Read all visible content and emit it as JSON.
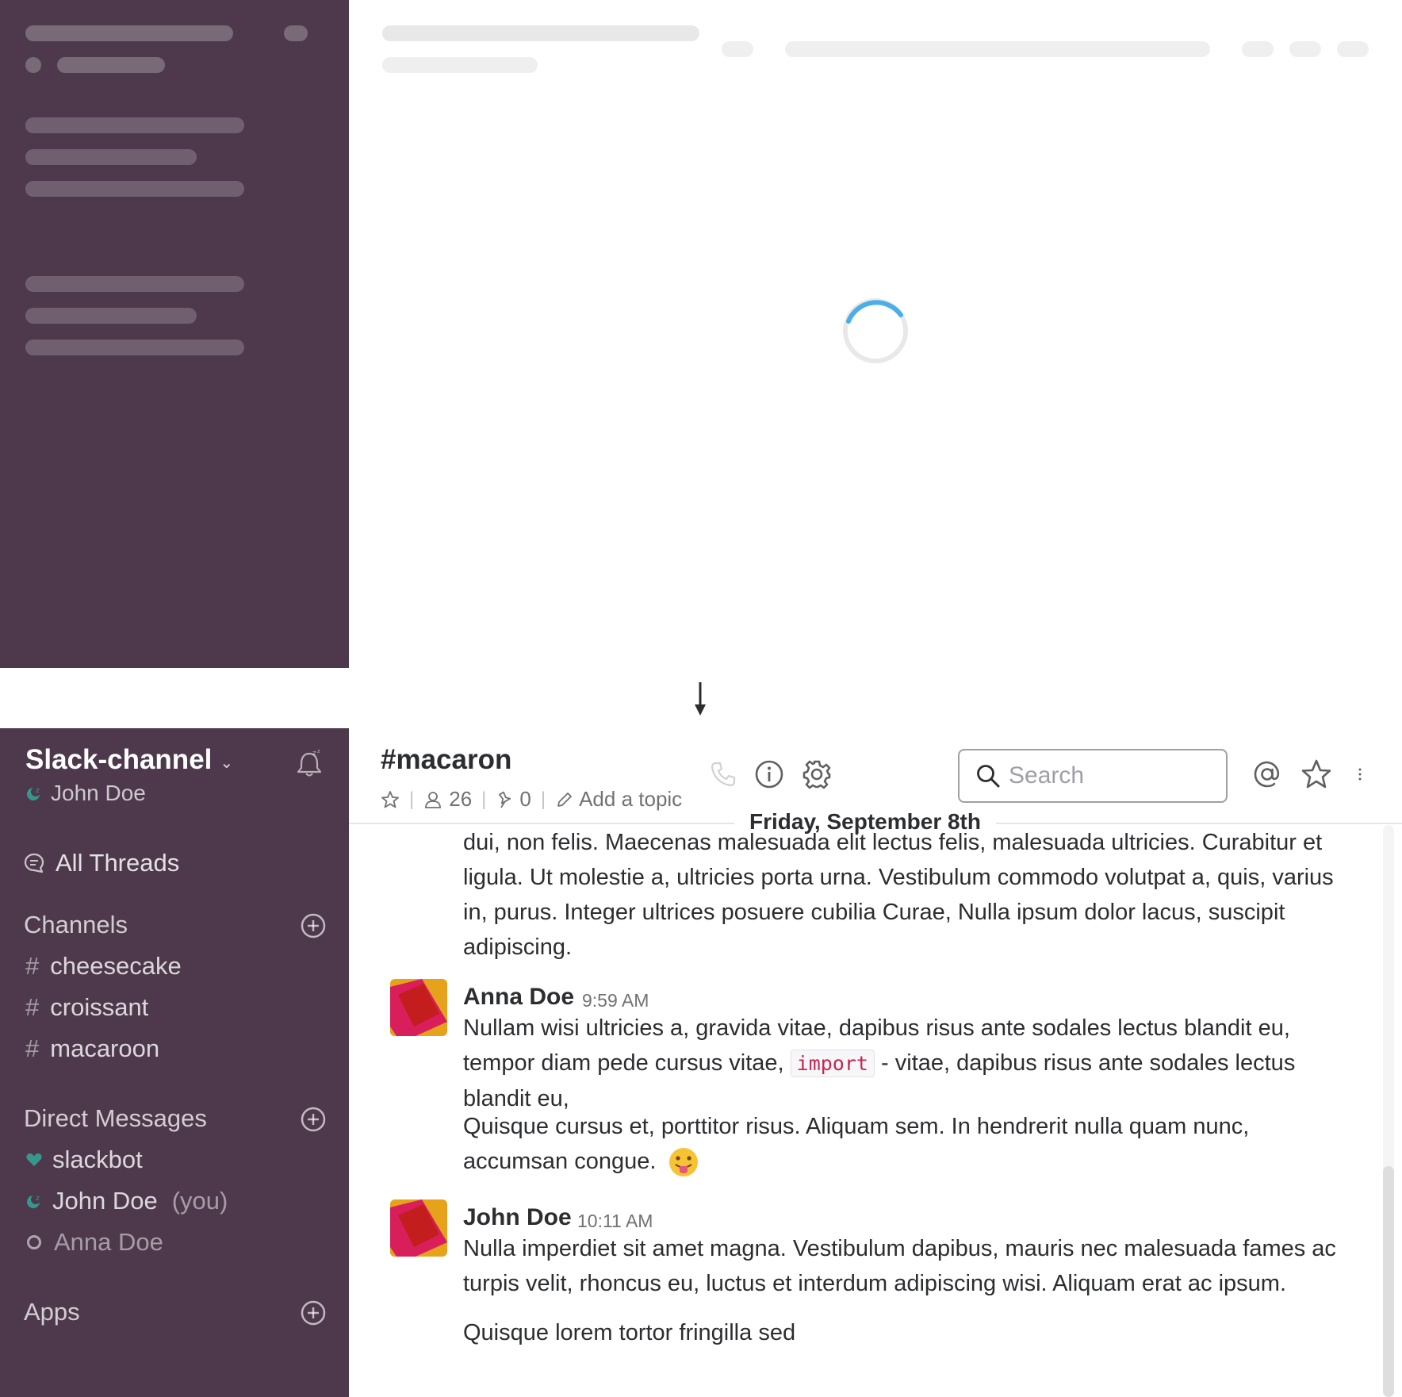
{
  "workspace": {
    "team_name": "Slack-channel",
    "current_user": "John Doe"
  },
  "sidebar": {
    "all_threads": "All Threads",
    "channels_heading": "Channels",
    "channels": [
      {
        "label": "cheesecake"
      },
      {
        "label": "croissant"
      },
      {
        "label": "macaroon"
      }
    ],
    "dm_heading": "Direct Messages",
    "dms": [
      {
        "label": "slackbot",
        "status": "heart"
      },
      {
        "label": "John Doe",
        "suffix": "(you)",
        "status": "away"
      },
      {
        "label": "Anna Doe",
        "status": "offline"
      }
    ],
    "apps_heading": "Apps",
    "hash_glyph": "#"
  },
  "channel": {
    "title": "#macaron",
    "members_count": "26",
    "pins_count": "0",
    "topic_placeholder": "Add a topic",
    "separator": "|"
  },
  "search": {
    "placeholder": "Search"
  },
  "day_divider": "Friday, September 8th",
  "messages": {
    "continued_text": "dui, non felis. Maecenas malesuada elit lectus felis, malesuada ultricies. Curabitur et ligula. Ut molestie a, ultricies porta urna. Vestibulum commodo volutpat a, quis, varius in, purus. Integer ultrices posuere cubilia Curae, Nulla ipsum dolor lacus, suscipit adipiscing.",
    "anna": {
      "author": "Anna Doe",
      "time": "9:59 AM",
      "text_before_code": "Nullam wisi ultricies a, gravida vitae, dapibus risus ante sodales lectus blandit eu, tempor diam pede cursus vitae,",
      "code": "import",
      "text_after_code": "- vitae, dapibus risus ante sodales lectus blandit eu,",
      "text_2": "Quisque cursus et, porttitor risus. Aliquam sem. In hendrerit nulla quam nunc, accumsan congue."
    },
    "john": {
      "author": "John Doe",
      "time": "10:11 AM",
      "text_1": "Nulla imperdiet sit amet magna. Vestibulum dapibus, mauris nec malesuada fames ac turpis velit, rhoncus eu, luctus et interdum adipiscing wisi. Aliquam erat ac ipsum.",
      "text_2": "Quisque lorem tortor fringilla sed"
    }
  },
  "colors": {
    "sidebar_bg": "#4d394b",
    "presence_green": "#38978d",
    "spinner_blue": "#4aaee8",
    "code_red": "#c7254e"
  },
  "icons": [
    "chevron-down-icon",
    "snooze-bell-icon",
    "threads-icon",
    "add-circle-icon",
    "heart-icon",
    "away-icon",
    "phone-icon",
    "info-icon",
    "gear-icon",
    "search-icon",
    "at-icon",
    "star-icon",
    "more-vertical-icon",
    "person-icon",
    "pin-icon",
    "pencil-icon",
    "loading-spinner",
    "arrow-down-icon"
  ]
}
